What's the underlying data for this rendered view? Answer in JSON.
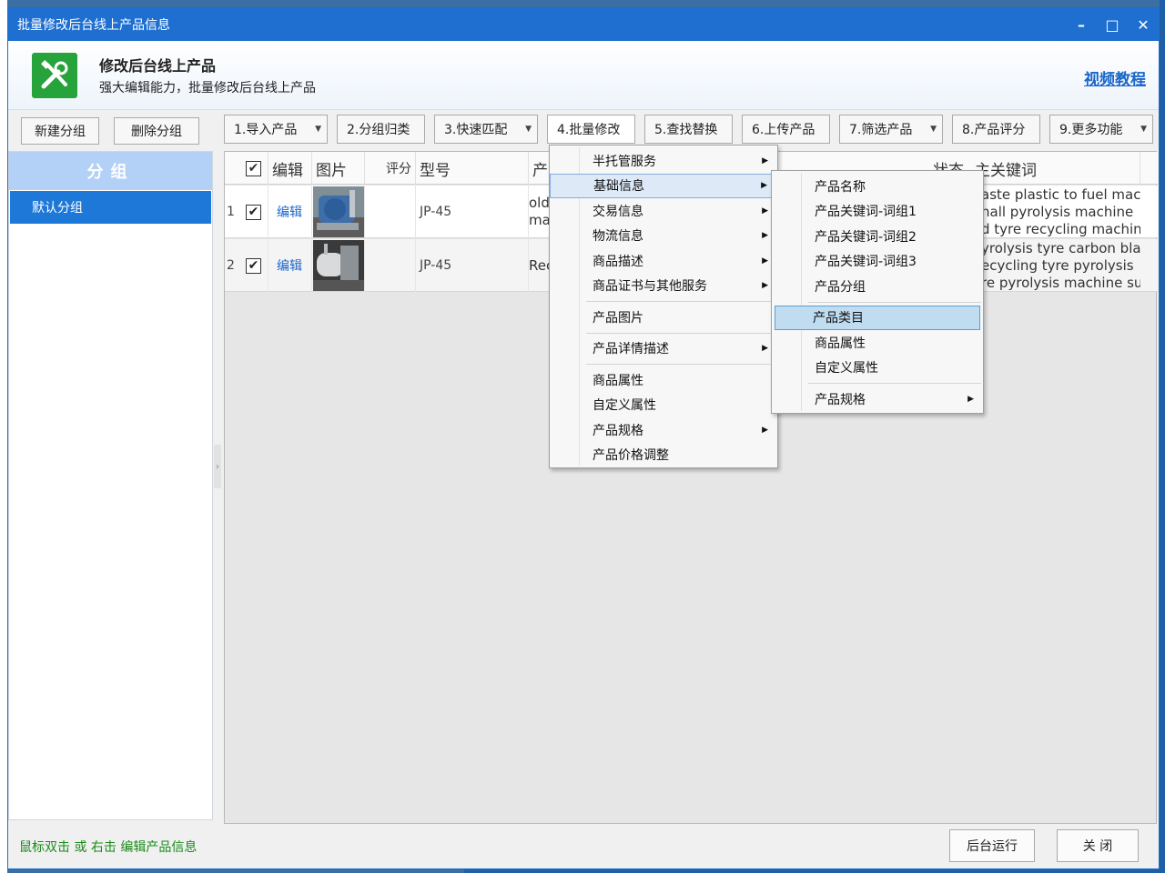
{
  "window": {
    "title": "批量修改后台线上产品信息",
    "controls": [
      "–",
      "□",
      "✕"
    ]
  },
  "header": {
    "title": "修改后台线上产品",
    "subtitle": "强大编辑能力，批量修改后台线上产品",
    "video_link": "视频教程"
  },
  "left_panel": {
    "new_group": "新建分组",
    "delete_group": "删除分组",
    "group_header": "分组",
    "groups": [
      "默认分组"
    ]
  },
  "toolbar": [
    {
      "label": "1.导入产品",
      "dropdown": true
    },
    {
      "label": "2.分组归类",
      "dropdown": false
    },
    {
      "label": "3.快速匹配",
      "dropdown": true
    },
    {
      "label": "4.批量修改",
      "dropdown": false
    },
    {
      "label": "5.查找替换",
      "dropdown": false
    },
    {
      "label": "6.上传产品",
      "dropdown": false
    },
    {
      "label": "7.筛选产品",
      "dropdown": true
    },
    {
      "label": "8.产品评分",
      "dropdown": false
    },
    {
      "label": "9.更多功能",
      "dropdown": true
    }
  ],
  "grid": {
    "columns": [
      "编辑",
      "图片",
      "评分",
      "型号",
      "产",
      "状态",
      "主关键词"
    ],
    "rows": [
      {
        "num": "1",
        "checked": true,
        "edit": "编辑",
        "score": "",
        "model": "JP-45",
        "product": [
          "old",
          "ma"
        ],
        "keywords": [
          "aste plastic to fuel mach",
          "nall pyrolysis machine",
          "d tyre recycling machin"
        ]
      },
      {
        "num": "2",
        "checked": true,
        "edit": "编辑",
        "score": "",
        "model": "JP-45",
        "product": [
          "Rec"
        ],
        "keywords": [
          "yrolysis tyre carbon blac",
          "ecycling tyre pyrolysis",
          "re pyrolysis machine su"
        ]
      }
    ]
  },
  "menu_main": [
    {
      "label": "半托管服务",
      "submenu": true
    },
    {
      "label": "基础信息",
      "submenu": true,
      "state": "highlighted"
    },
    {
      "label": "交易信息",
      "submenu": true
    },
    {
      "label": "物流信息",
      "submenu": true
    },
    {
      "label": "商品描述",
      "submenu": true
    },
    {
      "label": "商品证书与其他服务",
      "submenu": true
    },
    {
      "sep": true
    },
    {
      "label": "产品图片",
      "submenu": false
    },
    {
      "sep": true
    },
    {
      "label": "产品详情描述",
      "submenu": true
    },
    {
      "sep": true
    },
    {
      "label": "商品属性",
      "submenu": false
    },
    {
      "label": "自定义属性",
      "submenu": false
    },
    {
      "label": "产品规格",
      "submenu": true
    },
    {
      "label": "产品价格调整",
      "submenu": false
    }
  ],
  "menu_sub": [
    {
      "label": "产品名称",
      "submenu": false
    },
    {
      "label": "产品关键词-词组1",
      "submenu": false
    },
    {
      "label": "产品关键词-词组2",
      "submenu": false
    },
    {
      "label": "产品关键词-词组3",
      "submenu": false
    },
    {
      "label": "产品分组",
      "submenu": false
    },
    {
      "sep": true
    },
    {
      "label": "产品类目",
      "submenu": false,
      "state": "selected"
    },
    {
      "label": "商品属性",
      "submenu": false
    },
    {
      "label": "自定义属性",
      "submenu": false
    },
    {
      "sep": true
    },
    {
      "label": "产品规格",
      "submenu": true
    }
  ],
  "footer": {
    "tip": "鼠标双击 或 右击 编辑产品信息",
    "run_background": "后台运行",
    "close": "关 闭"
  },
  "colors": {
    "titlebar": "#1e6fd0",
    "accent": "#1e78d8",
    "link": "#1a66c9",
    "tip": "#1a8a1a",
    "icon_green": "#27a33b"
  }
}
